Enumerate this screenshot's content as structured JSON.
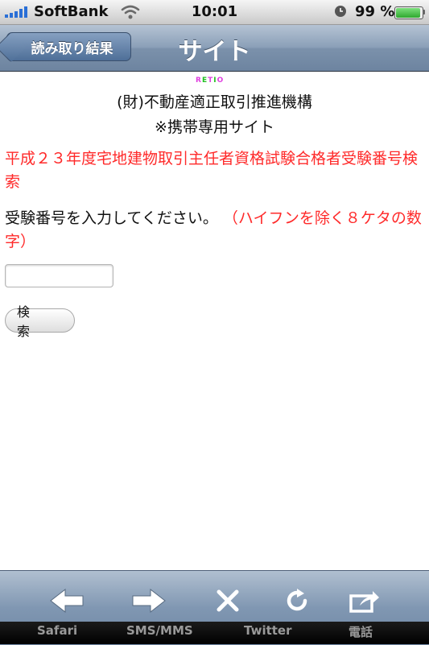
{
  "status_bar": {
    "carrier": "SoftBank",
    "time": "10:01",
    "battery_percent_text": "99 %",
    "battery_level": 0.99,
    "signal_bars": 5,
    "icons": [
      "signal-bars-icon",
      "wifi-icon",
      "alarm-clock-icon",
      "battery-icon"
    ]
  },
  "nav_bar": {
    "back_label": "読み取り結果",
    "title": "サイト"
  },
  "page": {
    "logo_text": "RETIO",
    "org_name": "(財)不動産適正取引推進機構",
    "mobile_site": "※携帯専用サイト",
    "heading": "平成２３年度宅地建物取引主任者資格試験合格者受験番号検索",
    "instruction": "受験番号を入力してください。",
    "instruction_note": "（ハイフンを除く８ケタの数字）",
    "input_value": "",
    "search_button": "検 索"
  },
  "toolbar": {
    "buttons": [
      "back-arrow-icon",
      "forward-arrow-icon",
      "close-x-icon",
      "reload-icon",
      "share-icon"
    ]
  },
  "tab_bar": {
    "labels": [
      "Safari",
      "SMS/MMS",
      "Twitter",
      "電話"
    ]
  },
  "colors": {
    "accent_red": "#ff2a2a",
    "nav_blue": "#7b91ab",
    "battery_green": "#2ea82e"
  }
}
